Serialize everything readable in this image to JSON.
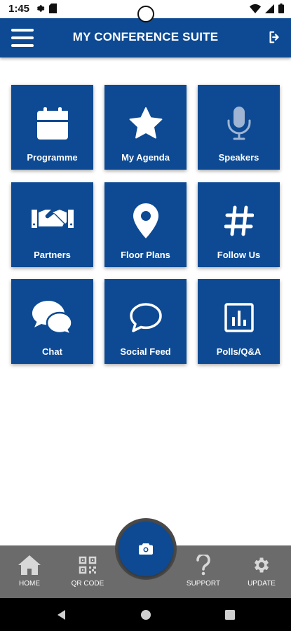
{
  "status_bar": {
    "time": "1:45"
  },
  "app_bar": {
    "title": "MY CONFERENCE SUITE"
  },
  "tiles": [
    {
      "label": "Programme",
      "icon": "calendar-icon"
    },
    {
      "label": "My Agenda",
      "icon": "star-icon"
    },
    {
      "label": "Speakers",
      "icon": "microphone-icon"
    },
    {
      "label": "Partners",
      "icon": "handshake-icon"
    },
    {
      "label": "Floor Plans",
      "icon": "map-pin-icon"
    },
    {
      "label": "Follow Us",
      "icon": "hashtag-icon"
    },
    {
      "label": "Chat",
      "icon": "chat-bubbles-icon"
    },
    {
      "label": "Social Feed",
      "icon": "speech-bubble-icon"
    },
    {
      "label": "Polls/Q&A",
      "icon": "poll-chart-icon"
    }
  ],
  "bottom_nav": {
    "home": "HOME",
    "qr_code": "QR CODE",
    "support": "SUPPORT",
    "update": "UPDATE"
  },
  "colors": {
    "brand_blue": "#0d4a93",
    "nav_gray": "#6b6b6b",
    "background": "#ffffff"
  }
}
